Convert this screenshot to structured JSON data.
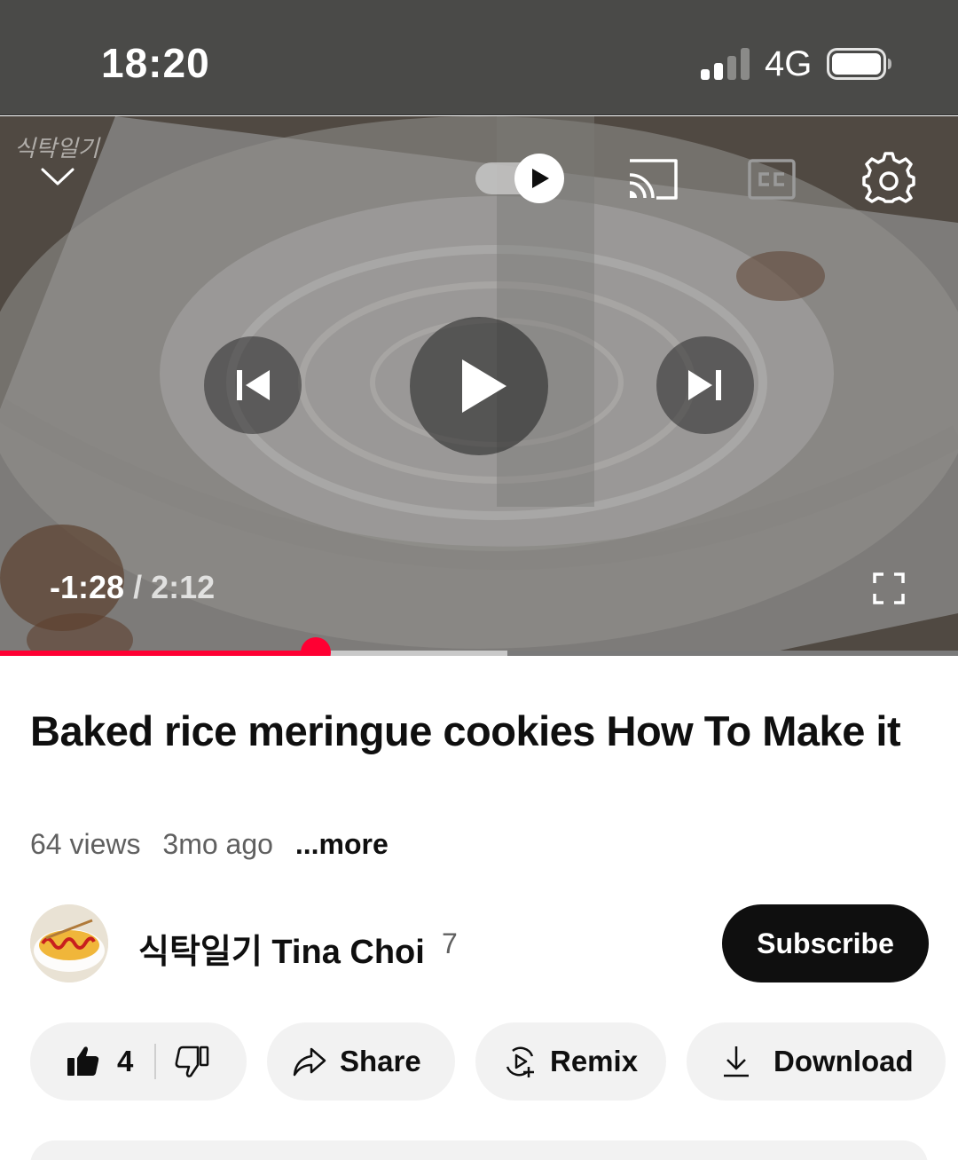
{
  "status_bar": {
    "time": "18:20",
    "network": "4G",
    "signal_bars_filled": 2,
    "signal_bars_total": 4,
    "battery_icon": "battery-icon"
  },
  "player": {
    "watermark": "식탁일기",
    "time_remaining": "-1:28",
    "separator": "/",
    "duration": "2:12",
    "progress_played_fraction": 0.33,
    "progress_buffered_fraction": 0.53,
    "autoplay_on": true,
    "icons": {
      "collapse": "chevron-down-icon",
      "autoplay": "autoplay-toggle-icon",
      "cast": "cast-icon",
      "captions": "cc-icon",
      "settings": "gear-icon",
      "previous": "skip-previous-icon",
      "play": "play-icon",
      "next": "skip-next-icon",
      "fullscreen": "fullscreen-icon"
    },
    "accent_color": "#ff0033"
  },
  "video": {
    "title": "Baked rice meringue cookies How To Make it",
    "views": "64 views",
    "age": "3mo ago",
    "more_label": "...more"
  },
  "channel": {
    "name": "식탁일기 Tina Choi",
    "subscriber_count": "7",
    "subscribe_label": "Subscribe"
  },
  "actions": {
    "like_count": "4",
    "share_label": "Share",
    "remix_label": "Remix",
    "download_label": "Download",
    "icons": {
      "like": "thumbs-up-icon",
      "dislike": "thumbs-down-icon",
      "share": "share-arrow-icon",
      "remix": "remix-icon",
      "download": "download-icon"
    }
  }
}
